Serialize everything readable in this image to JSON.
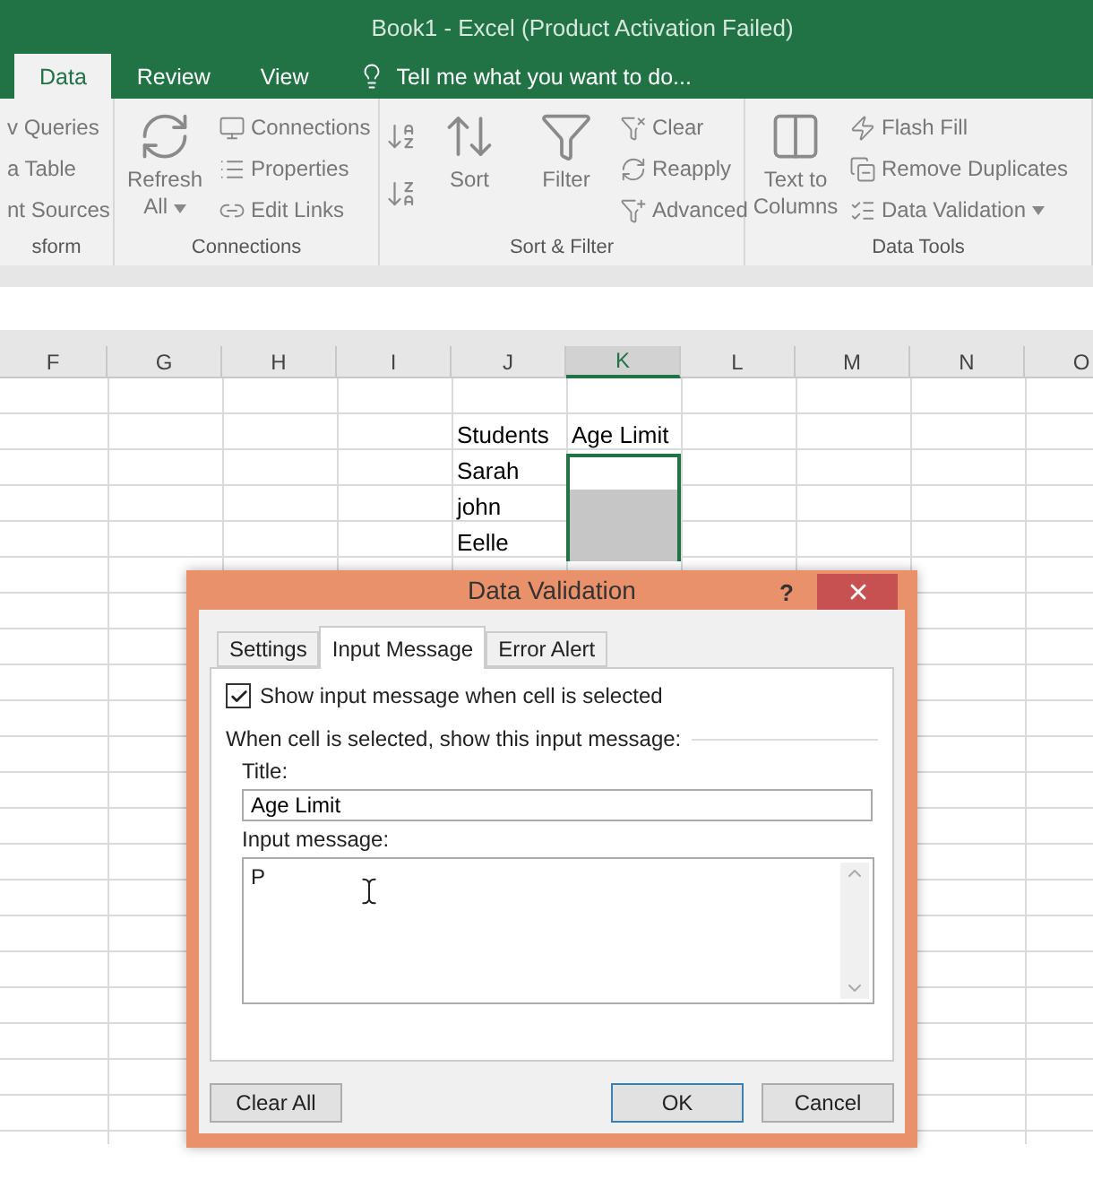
{
  "window": {
    "title": "Book1 - Excel (Product Activation Failed)"
  },
  "tabs": [
    {
      "label": "Data",
      "selected": true
    },
    {
      "label": "Review",
      "selected": false
    },
    {
      "label": "View",
      "selected": false
    }
  ],
  "tell_me": {
    "placeholder": "Tell me what you want to do..."
  },
  "ribbon_groups": [
    {
      "label": "sform",
      "items": [
        {
          "kind": "column",
          "items": [
            {
              "kind": "small",
              "label": "v Queries"
            },
            {
              "kind": "small",
              "label": "a Table"
            },
            {
              "kind": "small",
              "label": "nt Sources"
            }
          ]
        }
      ]
    },
    {
      "label": "Connections",
      "items": [
        {
          "kind": "large",
          "label": "Refresh All",
          "caret": true
        },
        {
          "kind": "column",
          "items": [
            {
              "kind": "small",
              "label": "Connections"
            },
            {
              "kind": "small",
              "label": "Properties"
            },
            {
              "kind": "small",
              "label": "Edit Links"
            }
          ]
        }
      ]
    },
    {
      "label": "Sort & Filter",
      "items": [
        {
          "kind": "sortpair"
        },
        {
          "kind": "large",
          "label": "Sort"
        },
        {
          "kind": "large",
          "label": "Filter"
        },
        {
          "kind": "column",
          "items": [
            {
              "kind": "small",
              "label": "Clear"
            },
            {
              "kind": "small",
              "label": "Reapply"
            },
            {
              "kind": "small",
              "label": "Advanced"
            }
          ]
        }
      ]
    },
    {
      "label": "Data Tools",
      "items": [
        {
          "kind": "large",
          "label": "Text to Columns"
        },
        {
          "kind": "column",
          "items": [
            {
              "kind": "small",
              "label": "Flash Fill"
            },
            {
              "kind": "small",
              "label": "Remove Duplicates"
            },
            {
              "kind": "small",
              "label": "Data Validation",
              "caret": true
            }
          ]
        }
      ]
    }
  ],
  "columns": [
    {
      "label": "F",
      "selected": false
    },
    {
      "label": "G",
      "selected": false
    },
    {
      "label": "H",
      "selected": false
    },
    {
      "label": "I",
      "selected": false
    },
    {
      "label": "J",
      "selected": false
    },
    {
      "label": "K",
      "selected": true
    },
    {
      "label": "L",
      "selected": false
    },
    {
      "label": "M",
      "selected": false
    },
    {
      "label": "N",
      "selected": false
    },
    {
      "label": "O",
      "selected": false
    }
  ],
  "rows": [
    {
      "students": "Students",
      "age": "Age Limit",
      "selected": false,
      "active": false
    },
    {
      "students": "Sarah",
      "age": "",
      "selected": true,
      "active": true
    },
    {
      "students": "john",
      "age": "",
      "selected": true,
      "active": false
    },
    {
      "students": "Eelle",
      "age": "",
      "selected": true,
      "active": false
    }
  ],
  "dialog": {
    "title": "Data Validation",
    "help": "?",
    "tabs": [
      {
        "label": "Settings",
        "selected": false
      },
      {
        "label": "Input Message",
        "selected": true
      },
      {
        "label": "Error Alert",
        "selected": false
      }
    ],
    "show_message": {
      "label": "Show input message when cell is selected",
      "checked": true
    },
    "section": "When cell is selected, show this input message:",
    "title_field": {
      "label": "Title:",
      "value": "Age Limit"
    },
    "message_field": {
      "label": "Input message:",
      "value": "P"
    },
    "buttons": [
      {
        "label": "Clear All",
        "default": false
      },
      {
        "label": "OK",
        "default": true
      },
      {
        "label": "Cancel",
        "default": false
      }
    ]
  }
}
